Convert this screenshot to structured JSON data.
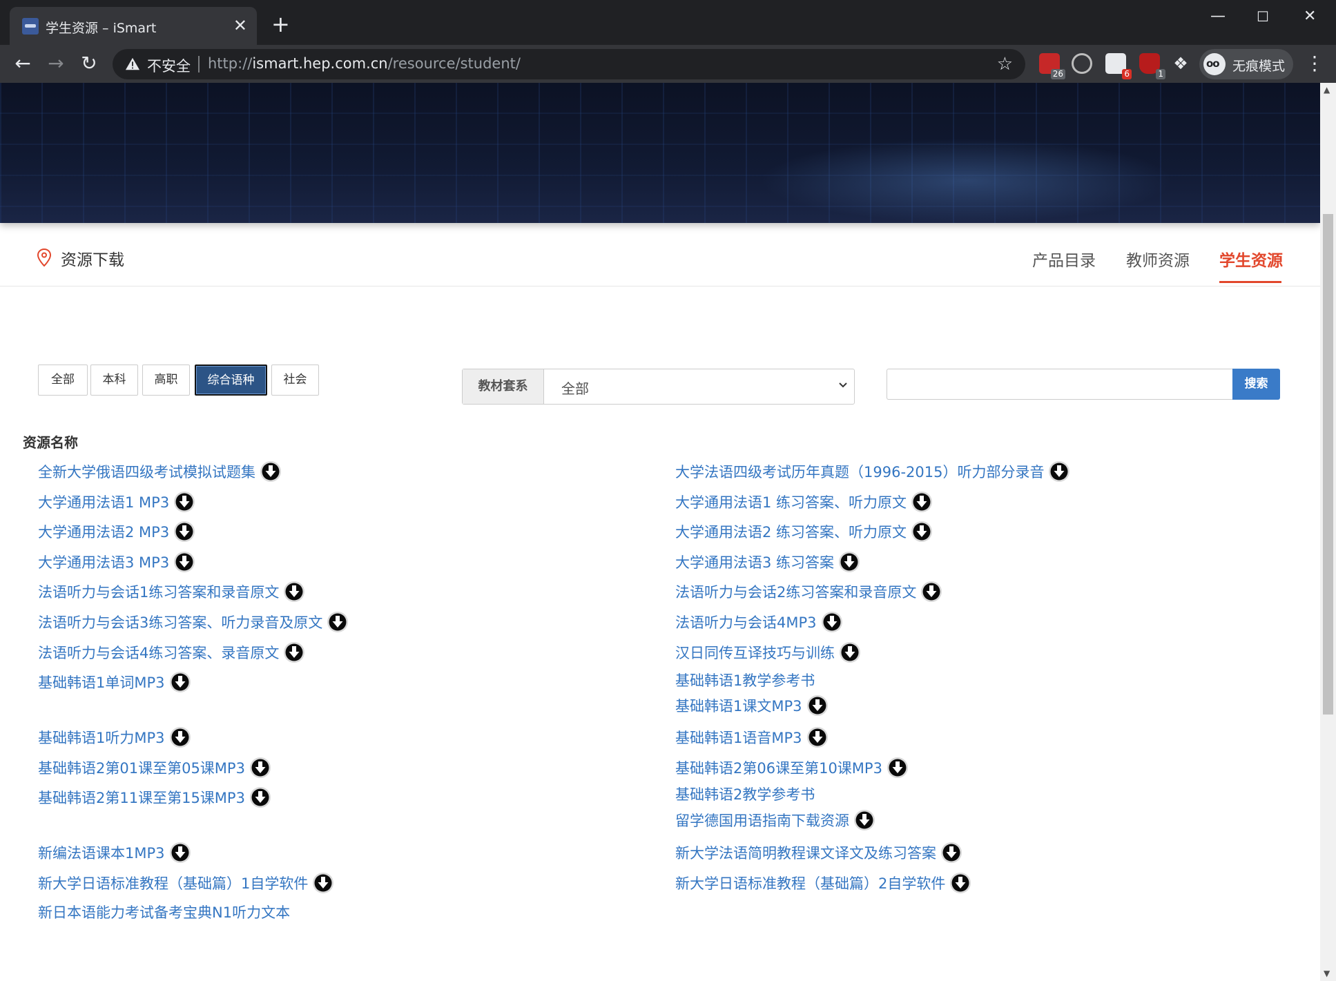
{
  "browser": {
    "tab_title": "学生资源 – iSmart",
    "tab_close": "✕",
    "new_tab": "+",
    "insecure_label": "不安全",
    "url_prefix": "http://",
    "url_host": "ismart.hep.com.cn",
    "url_path": "/resource/student/",
    "extensions": [
      {
        "name": "calendar-extension",
        "badge": "26"
      },
      {
        "name": "sync-extension",
        "badge": ""
      },
      {
        "name": "screen-extension",
        "badge": "6"
      },
      {
        "name": "ublock-extension",
        "badge": "1"
      }
    ],
    "incognito_label": "无痕模式"
  },
  "subnav": {
    "title": "资源下载",
    "links": [
      "产品目录",
      "教师资源",
      "学生资源"
    ],
    "active_index": 2,
    "accent_color": "#e2472c"
  },
  "filters": {
    "buttons": [
      "全部",
      "本科",
      "高职",
      "综合语种",
      "社会"
    ],
    "active_index": 3,
    "series_label": "教材套系",
    "series_value": "全部",
    "search_placeholder": "",
    "search_button": "搜索"
  },
  "resources": {
    "heading": "资源名称",
    "left": [
      {
        "name": "全新大学俄语四级考试模拟试题集",
        "download": true
      },
      {
        "name": "大学通用法语1 MP3",
        "download": true
      },
      {
        "name": "大学通用法语2 MP3",
        "download": true
      },
      {
        "name": "大学通用法语3 MP3",
        "download": true
      },
      {
        "name": "法语听力与会话1练习答案和录音原文",
        "download": true
      },
      {
        "name": "法语听力与会话3练习答案、听力录音及原文",
        "download": true
      },
      {
        "name": "法语听力与会话4练习答案、录音原文",
        "download": true
      },
      {
        "name": "基础韩语1单词MP3",
        "download": true
      },
      {
        "name": "基础韩语1听力MP3",
        "download": true
      },
      {
        "name": "基础韩语2第01课至第05课MP3",
        "download": true
      },
      {
        "name": "基础韩语2第11课至第15课MP3",
        "download": true
      },
      {
        "name": "新编法语课本1MP3",
        "download": true
      },
      {
        "name": "新大学日语标准教程（基础篇）1自学软件",
        "download": true
      },
      {
        "name": "新日本语能力考试备考宝典N1听力文本",
        "download": false
      }
    ],
    "right": [
      {
        "name": "大学法语四级考试历年真题（1996-2015）听力部分录音",
        "download": true
      },
      {
        "name": "大学通用法语1 练习答案、听力原文",
        "download": true
      },
      {
        "name": "大学通用法语2 练习答案、听力原文",
        "download": true
      },
      {
        "name": "大学通用法语3 练习答案",
        "download": true
      },
      {
        "name": "法语听力与会话2练习答案和录音原文",
        "download": true
      },
      {
        "name": "法语听力与会话4MP3",
        "download": true
      },
      {
        "name": "汉日同传互译技巧与训练",
        "download": true
      },
      {
        "name": "基础韩语1教学参考书",
        "download": false
      },
      {
        "name": "基础韩语1课文MP3",
        "download": true
      },
      {
        "name": "基础韩语1语音MP3",
        "download": true
      },
      {
        "name": "基础韩语2第06课至第10课MP3",
        "download": true
      },
      {
        "name": "基础韩语2教学参考书",
        "download": false
      },
      {
        "name": "留学德国用语指南下载资源",
        "download": true
      },
      {
        "name": "新大学法语简明教程课文译文及练习答案",
        "download": true
      },
      {
        "name": "新大学日语标准教程（基础篇）2自学软件",
        "download": true
      }
    ],
    "link_color": "#3476c2"
  }
}
